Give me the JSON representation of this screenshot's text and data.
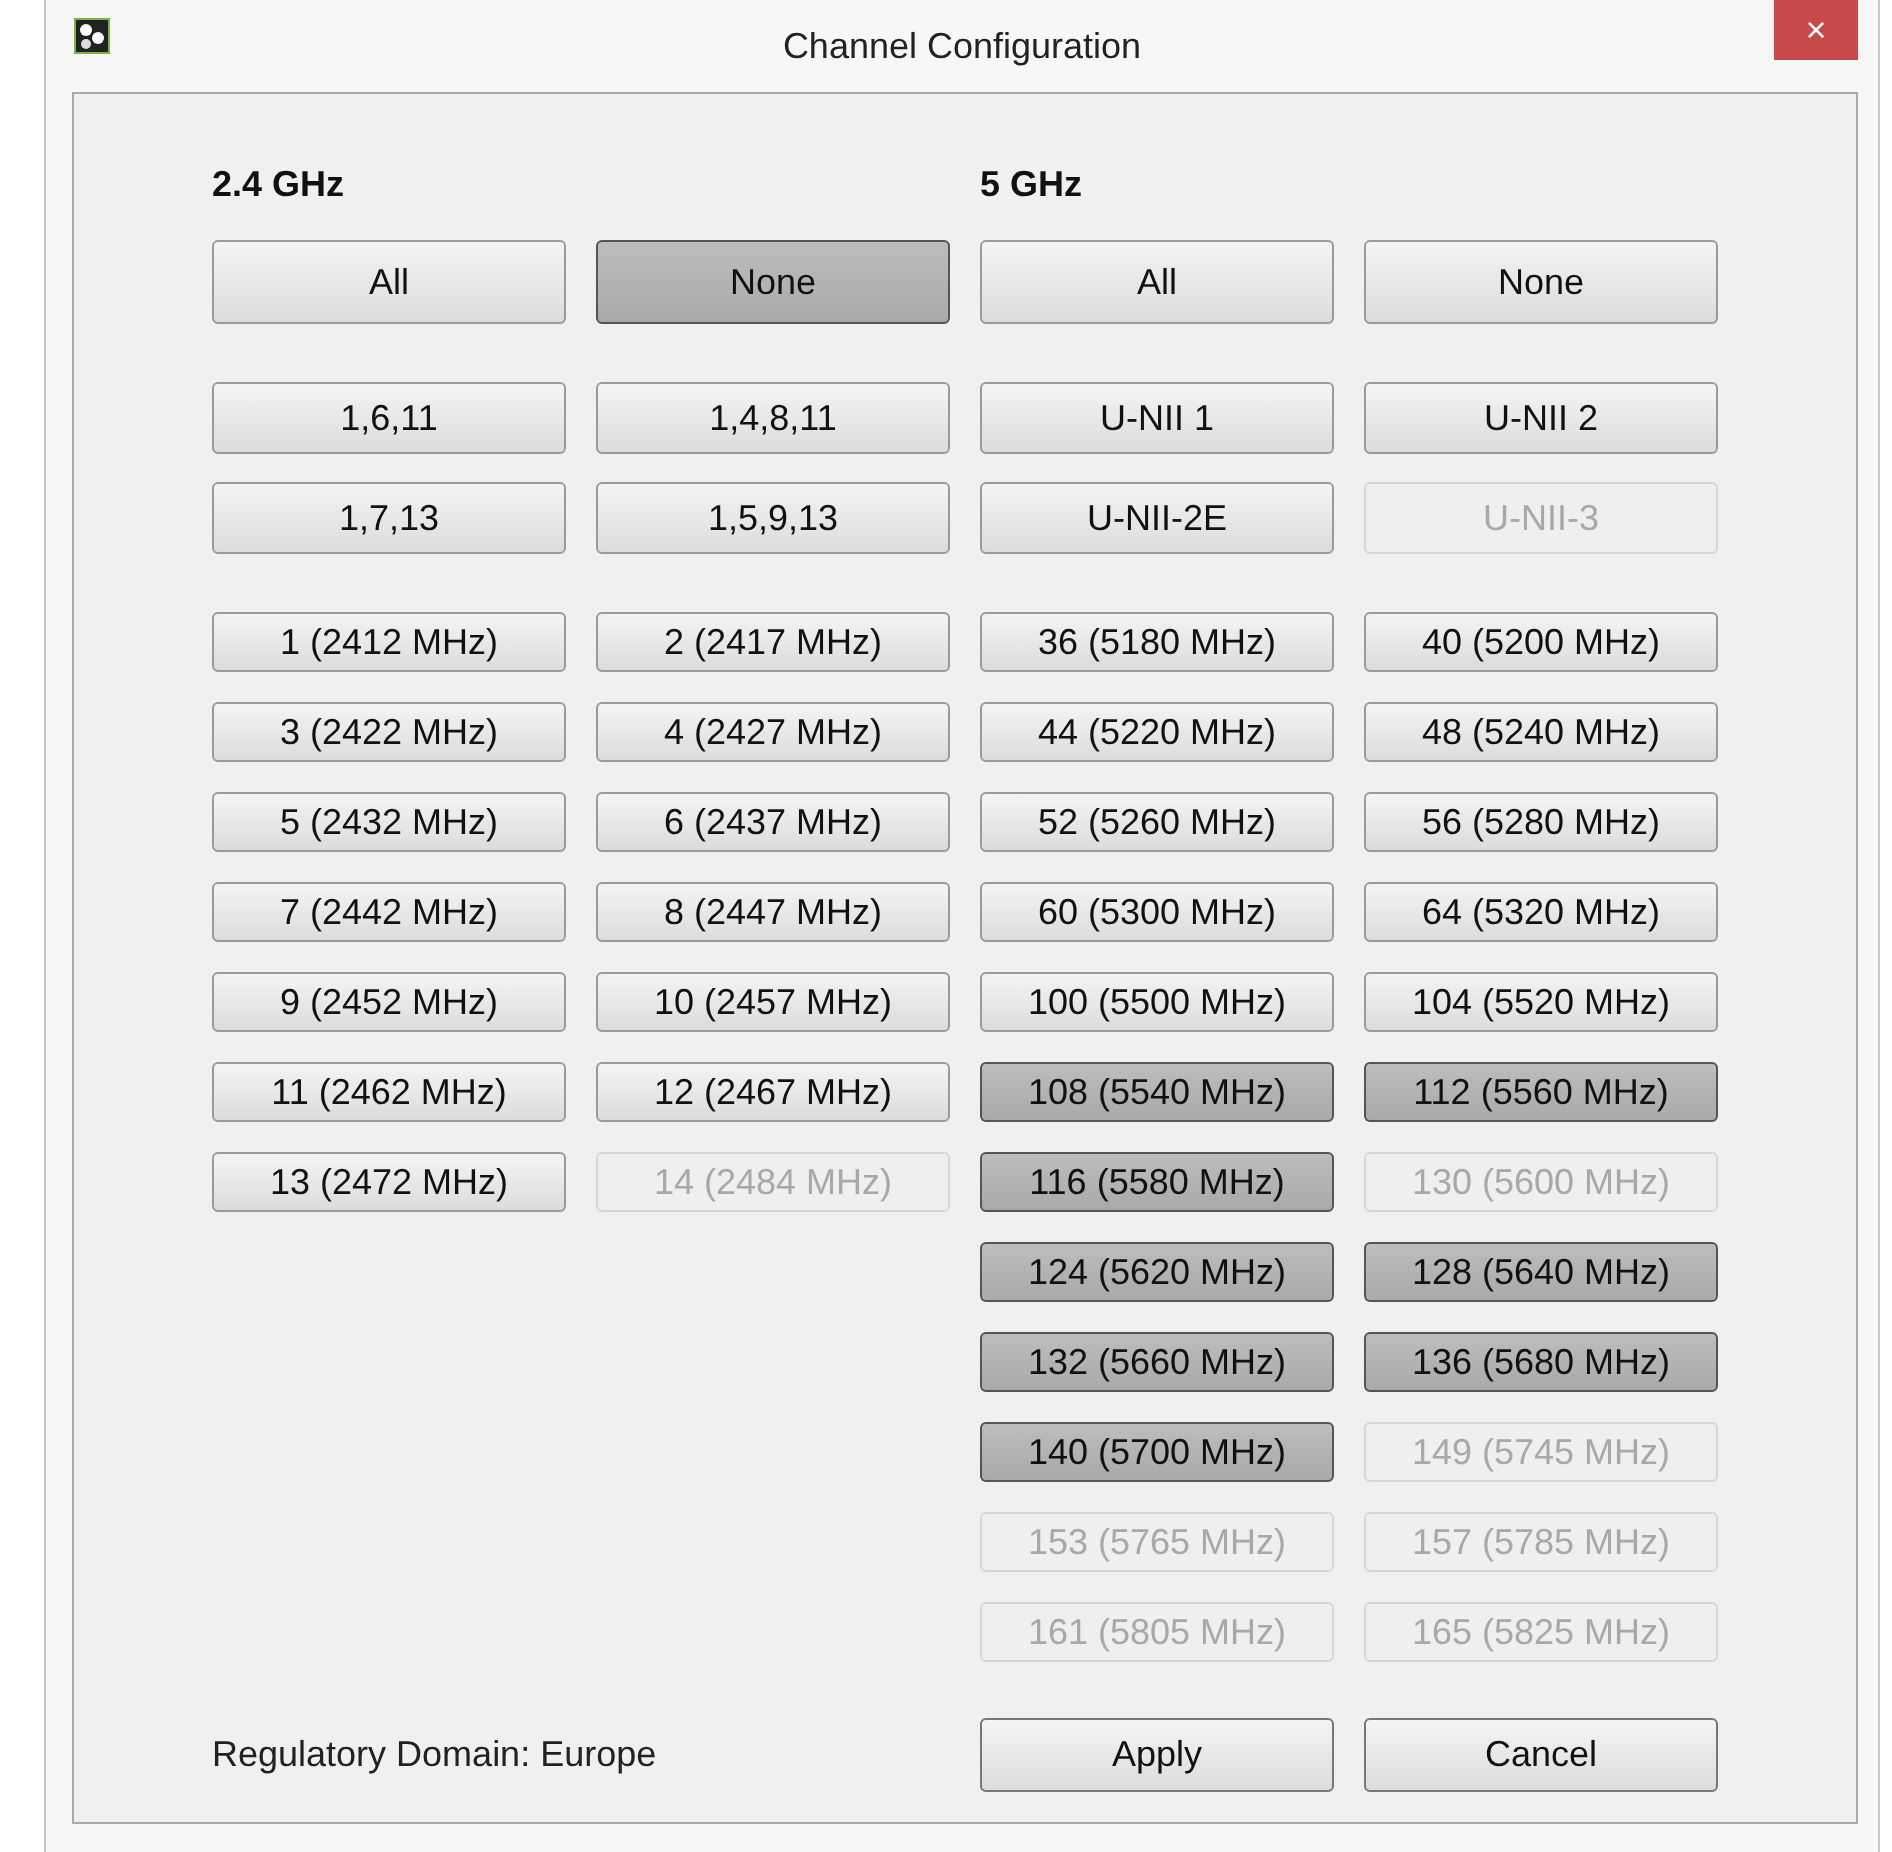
{
  "window": {
    "title": "Channel Configuration",
    "close": "×"
  },
  "headings": [
    "2.4 GHz",
    "5 GHz"
  ],
  "quick_buttons": [
    {
      "label": "All",
      "selected": false,
      "disabled": false
    },
    {
      "label": "None",
      "selected": true,
      "disabled": false
    },
    {
      "label": "All",
      "selected": false,
      "disabled": false
    },
    {
      "label": "None",
      "selected": false,
      "disabled": false
    }
  ],
  "presets": [
    {
      "label": "1,6,11",
      "selected": false,
      "disabled": false
    },
    {
      "label": "1,4,8,11",
      "selected": false,
      "disabled": false
    },
    {
      "label": "U-NII 1",
      "selected": false,
      "disabled": false
    },
    {
      "label": "U-NII 2",
      "selected": false,
      "disabled": false
    },
    {
      "label": "1,7,13",
      "selected": false,
      "disabled": false
    },
    {
      "label": "1,5,9,13",
      "selected": false,
      "disabled": false
    },
    {
      "label": "U-NII-2E",
      "selected": false,
      "disabled": false
    },
    {
      "label": "U-NII-3",
      "selected": false,
      "disabled": true
    }
  ],
  "channels_24": [
    {
      "label": "1 (2412 MHz)",
      "selected": false,
      "disabled": false
    },
    {
      "label": "2 (2417 MHz)",
      "selected": false,
      "disabled": false
    },
    {
      "label": "3 (2422 MHz)",
      "selected": false,
      "disabled": false
    },
    {
      "label": "4 (2427 MHz)",
      "selected": false,
      "disabled": false
    },
    {
      "label": "5 (2432 MHz)",
      "selected": false,
      "disabled": false
    },
    {
      "label": "6 (2437 MHz)",
      "selected": false,
      "disabled": false
    },
    {
      "label": "7 (2442 MHz)",
      "selected": false,
      "disabled": false
    },
    {
      "label": "8 (2447 MHz)",
      "selected": false,
      "disabled": false
    },
    {
      "label": "9 (2452 MHz)",
      "selected": false,
      "disabled": false
    },
    {
      "label": "10 (2457 MHz)",
      "selected": false,
      "disabled": false
    },
    {
      "label": "11 (2462 MHz)",
      "selected": false,
      "disabled": false
    },
    {
      "label": "12 (2467 MHz)",
      "selected": false,
      "disabled": false
    },
    {
      "label": "13 (2472 MHz)",
      "selected": false,
      "disabled": false
    },
    {
      "label": "14 (2484 MHz)",
      "selected": false,
      "disabled": true
    }
  ],
  "channels_5": [
    {
      "label": "36 (5180 MHz)",
      "selected": false,
      "disabled": false
    },
    {
      "label": "40 (5200 MHz)",
      "selected": false,
      "disabled": false
    },
    {
      "label": "44 (5220 MHz)",
      "selected": false,
      "disabled": false
    },
    {
      "label": "48 (5240 MHz)",
      "selected": false,
      "disabled": false
    },
    {
      "label": "52 (5260 MHz)",
      "selected": false,
      "disabled": false
    },
    {
      "label": "56 (5280 MHz)",
      "selected": false,
      "disabled": false
    },
    {
      "label": "60 (5300 MHz)",
      "selected": false,
      "disabled": false
    },
    {
      "label": "64 (5320 MHz)",
      "selected": false,
      "disabled": false
    },
    {
      "label": "100 (5500 MHz)",
      "selected": false,
      "disabled": false
    },
    {
      "label": "104 (5520 MHz)",
      "selected": false,
      "disabled": false
    },
    {
      "label": "108 (5540 MHz)",
      "selected": true,
      "disabled": false
    },
    {
      "label": "112 (5560 MHz)",
      "selected": true,
      "disabled": false
    },
    {
      "label": "116 (5580 MHz)",
      "selected": true,
      "disabled": false
    },
    {
      "label": "130 (5600 MHz)",
      "selected": false,
      "disabled": true
    },
    {
      "label": "124 (5620 MHz)",
      "selected": true,
      "disabled": false
    },
    {
      "label": "128 (5640 MHz)",
      "selected": true,
      "disabled": false
    },
    {
      "label": "132 (5660 MHz)",
      "selected": true,
      "disabled": false
    },
    {
      "label": "136 (5680 MHz)",
      "selected": true,
      "disabled": false
    },
    {
      "label": "140 (5700 MHz)",
      "selected": true,
      "disabled": false
    },
    {
      "label": "149 (5745 MHz)",
      "selected": false,
      "disabled": true
    },
    {
      "label": "153 (5765 MHz)",
      "selected": false,
      "disabled": true
    },
    {
      "label": "157 (5785 MHz)",
      "selected": false,
      "disabled": true
    },
    {
      "label": "161 (5805 MHz)",
      "selected": false,
      "disabled": true
    },
    {
      "label": "165 (5825 MHz)",
      "selected": false,
      "disabled": true
    }
  ],
  "regulatory_domain": "Regulatory Domain: Europe",
  "buttons": [
    "Apply",
    "Cancel"
  ]
}
